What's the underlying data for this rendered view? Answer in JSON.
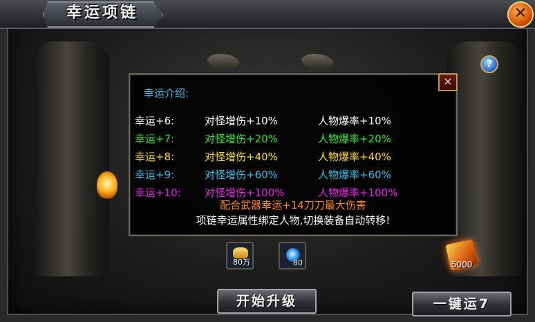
{
  "window": {
    "title": "幸运项链",
    "close_icon": "close-icon",
    "help_icon": "?"
  },
  "panel": {
    "title": "幸运介绍:",
    "close_label": "×",
    "rows": [
      {
        "luck": "幸运+6:",
        "monster": "对怪增伤+10%",
        "drop": "人物爆率+10%",
        "color": "#ffffff"
      },
      {
        "luck": "幸运+7:",
        "monster": "对怪增伤+20%",
        "drop": "人物爆率+20%",
        "color": "#2ee82e"
      },
      {
        "luck": "幸运+8:",
        "monster": "对怪增伤+40%",
        "drop": "人物爆率+40%",
        "color": "#ffe01a"
      },
      {
        "luck": "幸运+9:",
        "monster": "对怪增伤+60%",
        "drop": "人物爆率+60%",
        "color": "#32c3e8"
      },
      {
        "luck": "幸运+10:",
        "monster": "对怪增伤+100%",
        "drop": "人物爆率+100%",
        "color": "#e524e5"
      }
    ],
    "note1": "配合武器幸运+14刀刀最大伤害",
    "note1_color": "#ff8a1a",
    "note2": "项链幸运属性绑定人物,切换装备自动转移!",
    "note2_color": "#ffffff"
  },
  "costs": [
    {
      "icon": "gold-ingot-icon",
      "qty": "80万"
    },
    {
      "icon": "spirit-gem-icon",
      "qty": "80"
    }
  ],
  "luck_scroll": {
    "icon": "luck-scroll-icon",
    "qty": "5000"
  },
  "buttons": {
    "upgrade": "开始升级",
    "one_click": "一键运7"
  }
}
